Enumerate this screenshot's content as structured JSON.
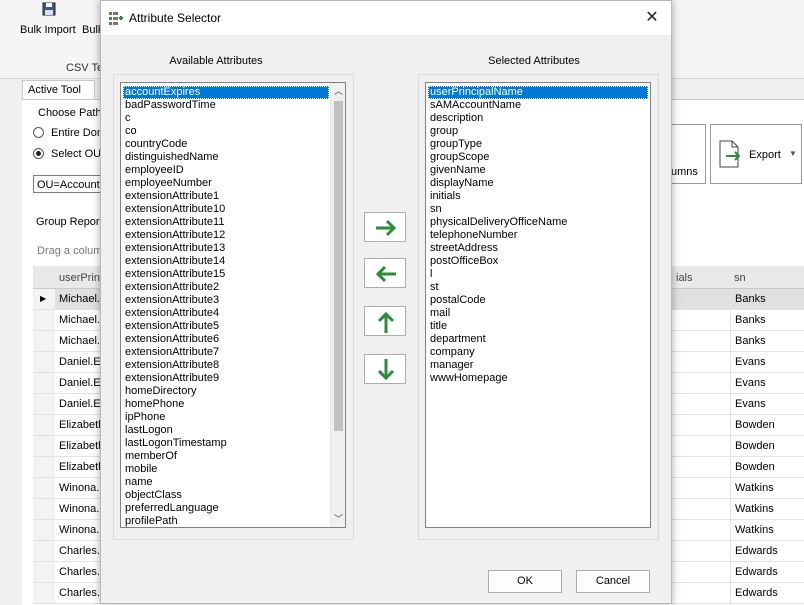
{
  "app": {
    "toolbar": {
      "bulk_import": "Bulk Import",
      "bulk_cut": "Bulk",
      "group_label": "CSV Te"
    },
    "tab_label": "Active Tool",
    "choose_path_label": "Choose Path",
    "entire_domain_label": "Entire Dom",
    "select_ou_label": "Select OU",
    "ou_value": "OU=Accounti",
    "group_report_label": "Group Report",
    "drag_hint": "Drag a colum",
    "columns_btn": "umns",
    "export_btn": "Export",
    "grid": {
      "col1_header": "userPrin",
      "col_mid_header": "ials",
      "col_sn_header": "sn",
      "rows": [
        {
          "name": "Michael.",
          "sn": "Banks"
        },
        {
          "name": "Michael.",
          "sn": "Banks"
        },
        {
          "name": "Michael.",
          "sn": "Banks"
        },
        {
          "name": "Daniel.E",
          "sn": "Evans"
        },
        {
          "name": "Daniel.E",
          "sn": "Evans"
        },
        {
          "name": "Daniel.E",
          "sn": "Evans"
        },
        {
          "name": "Elizabeth",
          "sn": "Bowden"
        },
        {
          "name": "Elizabeth",
          "sn": "Bowden"
        },
        {
          "name": "Elizabeth",
          "sn": "Bowden"
        },
        {
          "name": "Winona.",
          "sn": "Watkins"
        },
        {
          "name": "Winona.",
          "sn": "Watkins"
        },
        {
          "name": "Winona.",
          "sn": "Watkins"
        },
        {
          "name": "Charles.",
          "sn": "Edwards"
        },
        {
          "name": "Charles.",
          "sn": "Edwards"
        },
        {
          "name": "Charles.",
          "sn": "Edwards"
        }
      ]
    }
  },
  "dialog": {
    "title": "Attribute Selector",
    "available_label": "Available Attributes",
    "selected_label": "Selected Attributes",
    "available": [
      "accountExpires",
      "badPasswordTime",
      "c",
      "co",
      "countryCode",
      "distinguishedName",
      "employeeID",
      "employeeNumber",
      "extensionAttribute1",
      "extensionAttribute10",
      "extensionAttribute11",
      "extensionAttribute12",
      "extensionAttribute13",
      "extensionAttribute14",
      "extensionAttribute15",
      "extensionAttribute2",
      "extensionAttribute3",
      "extensionAttribute4",
      "extensionAttribute5",
      "extensionAttribute6",
      "extensionAttribute7",
      "extensionAttribute8",
      "extensionAttribute9",
      "homeDirectory",
      "homePhone",
      "ipPhone",
      "lastLogon",
      "lastLogonTimestamp",
      "memberOf",
      "mobile",
      "name",
      "objectClass",
      "preferredLanguage",
      "profilePath"
    ],
    "selected": [
      "userPrincipalName",
      "sAMAccountName",
      "description",
      "group",
      "groupType",
      "groupScope",
      "givenName",
      "displayName",
      "initials",
      "sn",
      "physicalDeliveryOfficeName",
      "telephoneNumber",
      "streetAddress",
      "postOfficeBox",
      "l",
      "st",
      "postalCode",
      "mail",
      "title",
      "department",
      "company",
      "manager",
      "wwwHomepage"
    ],
    "ok_label": "OK",
    "cancel_label": "Cancel",
    "accent_color": "#2e8b3a",
    "selection_color": "#0078d7"
  }
}
